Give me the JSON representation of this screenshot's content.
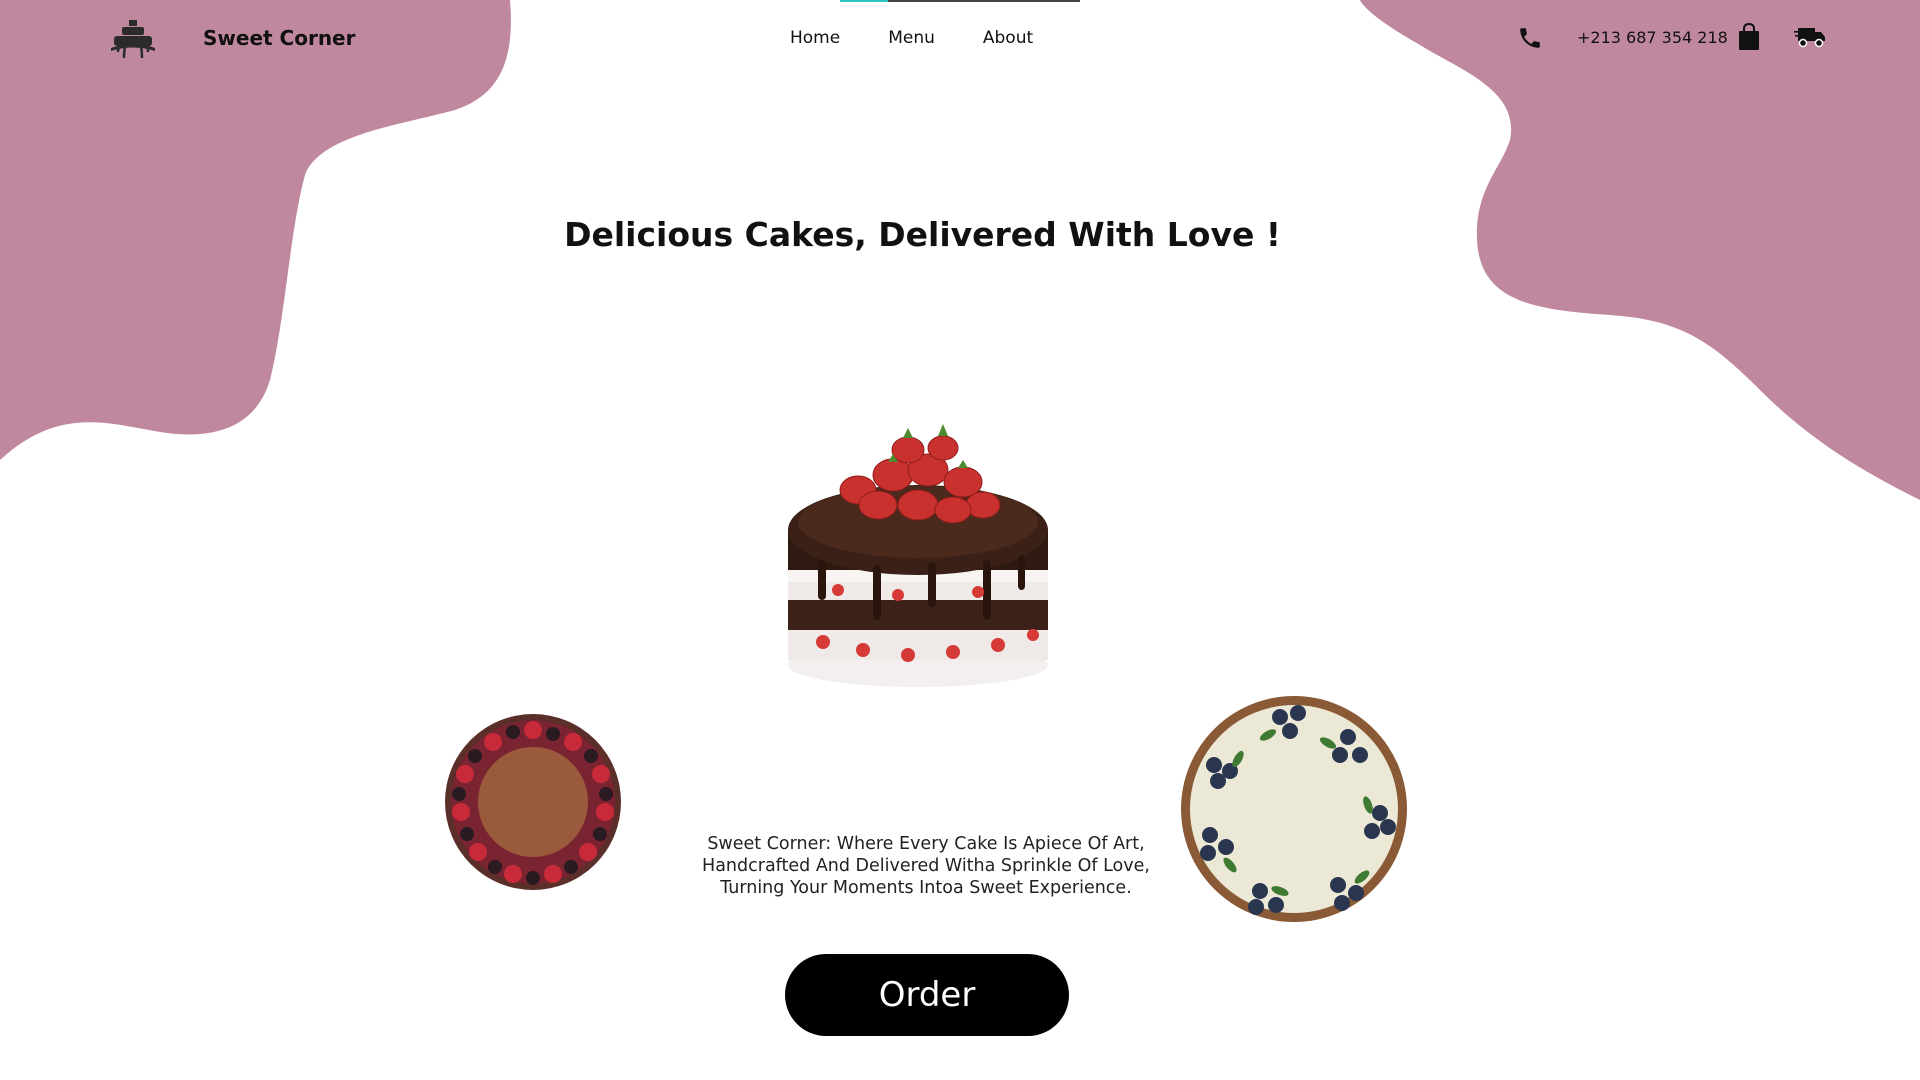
{
  "header": {
    "brand": "Sweet Corner",
    "logo_icon": "cake-stand-icon",
    "nav": [
      {
        "label": "Home"
      },
      {
        "label": "Menu"
      },
      {
        "label": "About"
      }
    ],
    "phone_icon": "phone-icon",
    "phone": "+213 687 354 218",
    "bag_icon": "shopping-bag-icon",
    "truck_icon": "delivery-truck-icon"
  },
  "hero": {
    "headline": "Delicious Cakes, Delivered With Love !",
    "tagline": "Sweet Corner: Where Every Cake Is Apiece Of Art, Handcrafted And Delivered Witha Sprinkle Of Love, Turning Your Moments Intoa Sweet Experience.",
    "order_label": "Order"
  },
  "colors": {
    "blob": "#bf889e",
    "accent_line": "#2ec4c4",
    "button": "#000000",
    "text": "#111111"
  }
}
